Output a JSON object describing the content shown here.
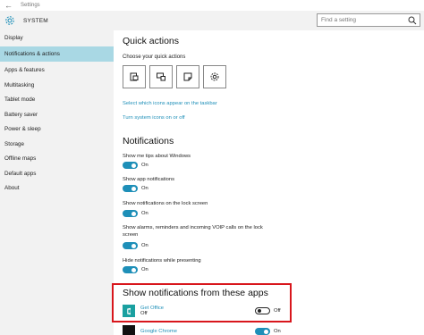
{
  "window": {
    "title": "Settings"
  },
  "header": {
    "section": "SYSTEM",
    "search_placeholder": "Find a setting"
  },
  "sidebar": {
    "items": [
      {
        "label": "Display"
      },
      {
        "label": "Notifications & actions"
      },
      {
        "label": "Apps & features"
      },
      {
        "label": "Multitasking"
      },
      {
        "label": "Tablet mode"
      },
      {
        "label": "Battery saver"
      },
      {
        "label": "Power & sleep"
      },
      {
        "label": "Storage"
      },
      {
        "label": "Offline maps"
      },
      {
        "label": "Default apps"
      },
      {
        "label": "About"
      }
    ]
  },
  "quick_actions": {
    "title": "Quick actions",
    "subtitle": "Choose your quick actions",
    "buttons": [
      "tablet-mode-icon",
      "connect-icon",
      "note-icon",
      "settings-icon"
    ],
    "link_taskbar": "Select which icons appear on the taskbar",
    "link_system": "Turn system icons on or off"
  },
  "notifications": {
    "title": "Notifications",
    "settings": [
      {
        "label": "Show me tips about Windows",
        "state": "On"
      },
      {
        "label": "Show app notifications",
        "state": "On"
      },
      {
        "label": "Show notifications on the lock screen",
        "state": "On"
      },
      {
        "label": "Show alarms, reminders and incoming VOIP calls on the lock screen",
        "state": "On"
      },
      {
        "label": "Hide notifications while presenting",
        "state": "On"
      }
    ]
  },
  "apps_section": {
    "title": "Show notifications from these apps",
    "apps": [
      {
        "name": "Get Office",
        "status": "Off",
        "toggle": "Off"
      },
      {
        "name": "Google Chrome",
        "toggle": "On"
      }
    ]
  },
  "colors": {
    "accent": "#1e8fb8",
    "selected": "#a9d8e4",
    "highlight_box": "#d8161c"
  }
}
